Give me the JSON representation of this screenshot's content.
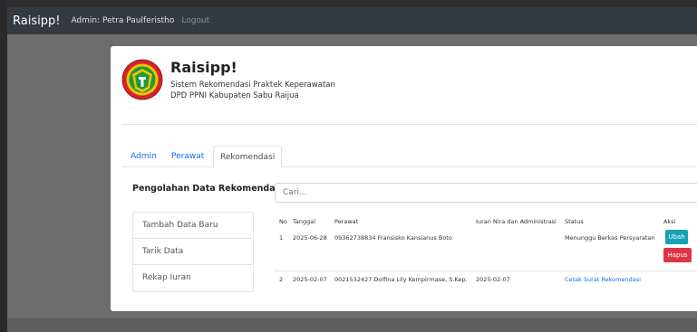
{
  "navbar": {
    "brand": "Raisipp!",
    "user": "Admin: Petra Paulferistho",
    "logout": "Logout"
  },
  "header": {
    "title": "Raisipp!",
    "subtitle_1": "Sistem Rekomendasi Praktek Keperawatan",
    "subtitle_2": "DPD PPNI Kabupaten Sabu Raijua"
  },
  "tabs": [
    {
      "label": "Admin",
      "active": false
    },
    {
      "label": "Perawat",
      "active": false
    },
    {
      "label": "Rekomendasi",
      "active": true
    }
  ],
  "sidebar": {
    "title": "Pengolahan Data Rekomendasi",
    "items": [
      {
        "label": "Tambah Data Baru"
      },
      {
        "label": "Tarik Data"
      },
      {
        "label": "Rekap Iuran"
      }
    ]
  },
  "search": {
    "placeholder": "Cari..."
  },
  "table": {
    "headers": [
      "No",
      "Tanggal",
      "Perawat",
      "Iuran Nira dan Administrasi",
      "Status",
      "Aksi"
    ],
    "rows": [
      {
        "no": "1",
        "tanggal": "2025-06-28",
        "perawat": "09362738834 Fransisko Kansianus Boto",
        "iuran": "",
        "status": "Menunggu Berkas Persyaratan",
        "ubah": "Ubah",
        "hapus": "Hapus"
      },
      {
        "no": "2",
        "tanggal": "2025-02-07",
        "perawat": "0021532427 Dolfina Lily Kempirmase, S.Kep.",
        "iuran": "2025-02-07",
        "status": "Cetak Surat Rekomendasi"
      }
    ]
  },
  "colors": {
    "navbar": "#343a40",
    "link": "#0d6efd",
    "info_button": "#17a2b8",
    "danger_button": "#dc3545",
    "logo_green": "#1b9a3c",
    "logo_yellow": "#f2c200",
    "logo_red": "#d3242b"
  },
  "icons": {
    "logo": "ppni-logo"
  }
}
